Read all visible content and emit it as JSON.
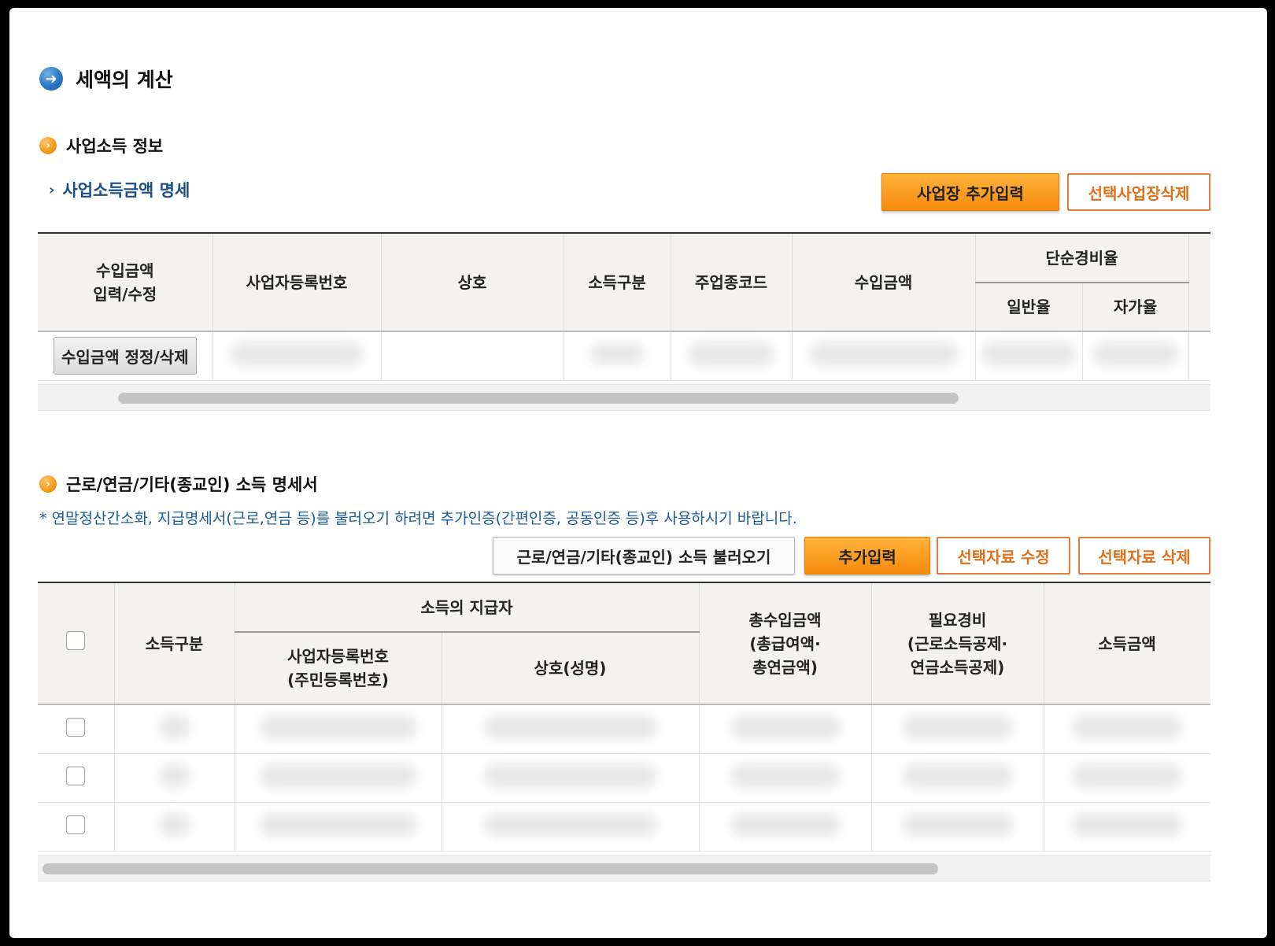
{
  "page_title": "세액의 계산",
  "business": {
    "section_title": "사업소득 정보",
    "subtitle": "사업소득금액 명세",
    "add_button": "사업장 추가입력",
    "delete_button": "선택사업장삭제",
    "headers": {
      "income_edit_line1": "수입금액",
      "income_edit_line2": "입력/수정",
      "reg_no": "사업자등록번호",
      "company": "상호",
      "income_type": "소득구분",
      "industry_code": "주업종코드",
      "revenue": "수입금액",
      "simple_rate": "단순경비율",
      "general_rate": "일반율",
      "own_rate": "자가율"
    },
    "row_button": "수입금액 정정/삭제"
  },
  "other": {
    "section_title": "근로/연금/기타(종교인) 소득 명세서",
    "notice": "* 연말정산간소화, 지급명세서(근로,연금 등)를 불러오기 하려면 추가인증(간편인증, 공동인증 등)후 사용하시기 바랍니다.",
    "load_button": "근로/연금/기타(종교인) 소득 불러오기",
    "add_button": "추가입력",
    "edit_button": "선택자료 수정",
    "delete_button": "선택자료 삭제",
    "headers": {
      "income_type": "소득구분",
      "payer": "소득의 지급자",
      "reg_no_line1": "사업자등록번호",
      "reg_no_line2": "(주민등록번호)",
      "name": "상호(성명)",
      "total_line1": "총수입금액",
      "total_line2": "(총급여액·",
      "total_line3": "총연금액)",
      "expense_line1": "필요경비",
      "expense_line2": "(근로소득공제·",
      "expense_line3": "연금소득공제)",
      "income_amount": "소득금액"
    }
  }
}
